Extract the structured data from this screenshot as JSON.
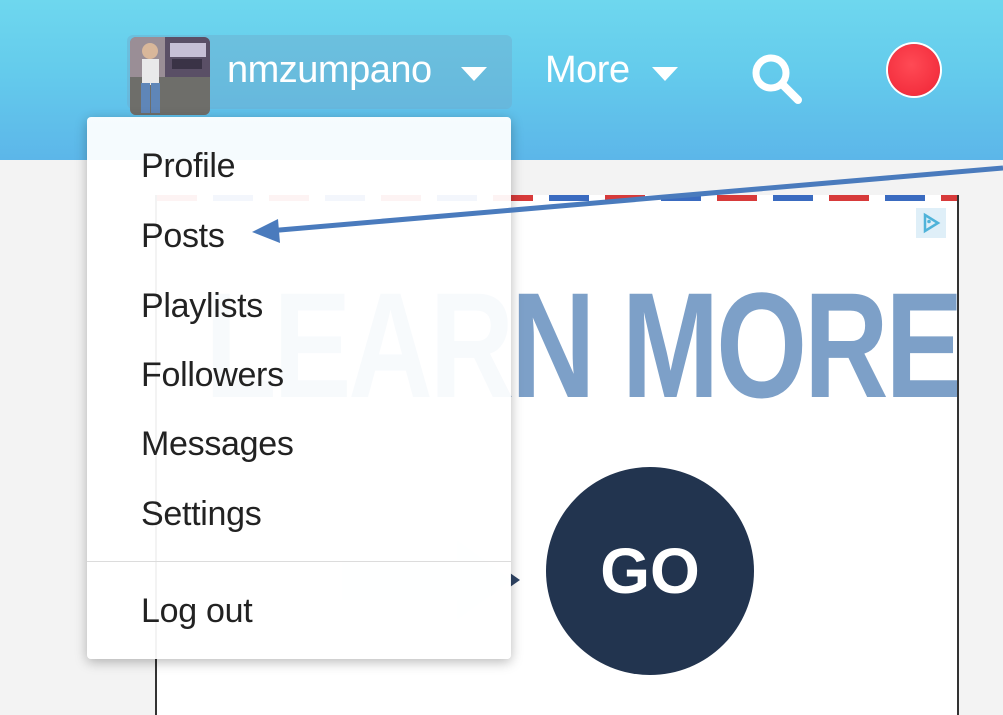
{
  "header": {
    "username": "nmzumpano",
    "more_label": "More"
  },
  "menu": {
    "items": [
      {
        "label": "Profile"
      },
      {
        "label": "Posts"
      },
      {
        "label": "Playlists"
      },
      {
        "label": "Followers"
      },
      {
        "label": "Messages"
      },
      {
        "label": "Settings"
      }
    ],
    "logout_label": "Log out"
  },
  "ad": {
    "headline": "LEARN MORE.",
    "button_label": "GO"
  },
  "icons": {
    "search": "search-icon",
    "record": "record-icon",
    "avatar": "avatar",
    "ad_choices": "ad-choices-icon",
    "caret": "chevron-down-icon"
  },
  "colors": {
    "header_top": "#6ed7ee",
    "header_bottom": "#5cb6e9",
    "record": "#ef2435",
    "ad_headline": "#7da0c8",
    "go_button": "#22344f",
    "annotation_arrow": "#4a7bbd"
  }
}
